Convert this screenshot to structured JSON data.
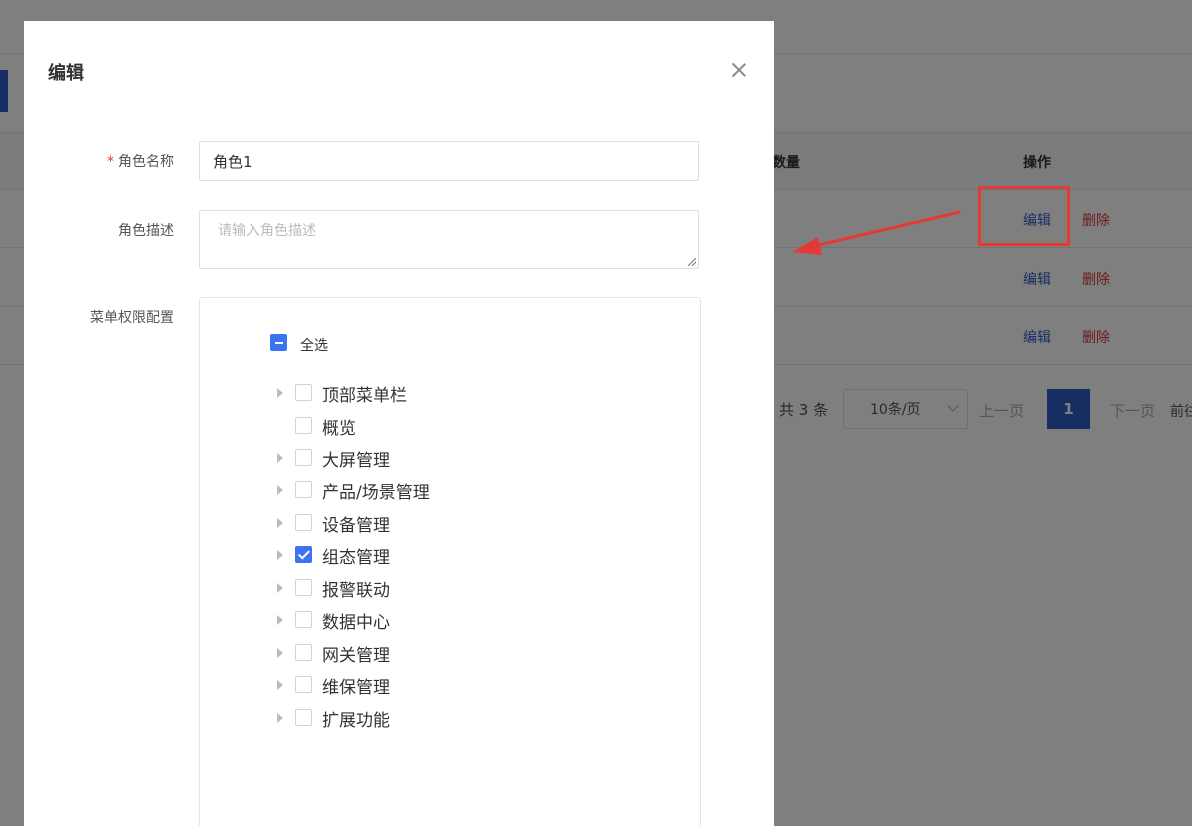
{
  "background": {
    "table": {
      "headers": {
        "count": "数量",
        "actions": "操作"
      },
      "rows": [
        {
          "edit": "编辑",
          "delete": "删除"
        },
        {
          "edit": "编辑",
          "delete": "删除"
        },
        {
          "edit": "编辑",
          "delete": "删除"
        }
      ]
    },
    "pagination": {
      "total": "共 3 条",
      "page_size": "10条/页",
      "prev": "上一页",
      "current_page": "1",
      "next": "下一页",
      "goto": "前往"
    }
  },
  "modal": {
    "title": "编辑",
    "form": {
      "name_required_mark": "*",
      "name_label": "角色名称",
      "name_value": "角色1",
      "desc_label": "角色描述",
      "desc_placeholder": "请输入角色描述",
      "menu_label": "菜单权限配置"
    },
    "tree": {
      "select_all": "全选",
      "select_all_state": "indeterminate",
      "items": [
        {
          "label": "顶部菜单栏",
          "expandable": true,
          "checked": false
        },
        {
          "label": "概览",
          "expandable": false,
          "checked": false
        },
        {
          "label": "大屏管理",
          "expandable": true,
          "checked": false
        },
        {
          "label": "产品/场景管理",
          "expandable": true,
          "checked": false
        },
        {
          "label": "设备管理",
          "expandable": true,
          "checked": false
        },
        {
          "label": "组态管理",
          "expandable": true,
          "checked": true
        },
        {
          "label": "报警联动",
          "expandable": true,
          "checked": false
        },
        {
          "label": "数据中心",
          "expandable": true,
          "checked": false
        },
        {
          "label": "网关管理",
          "expandable": true,
          "checked": false
        },
        {
          "label": "维保管理",
          "expandable": true,
          "checked": false
        },
        {
          "label": "扩展功能",
          "expandable": true,
          "checked": false
        }
      ]
    }
  },
  "colors": {
    "primary": "#2f5cc7",
    "checkbox": "#3b73f0",
    "danger": "#d9363e",
    "annotation": "#e53935"
  }
}
